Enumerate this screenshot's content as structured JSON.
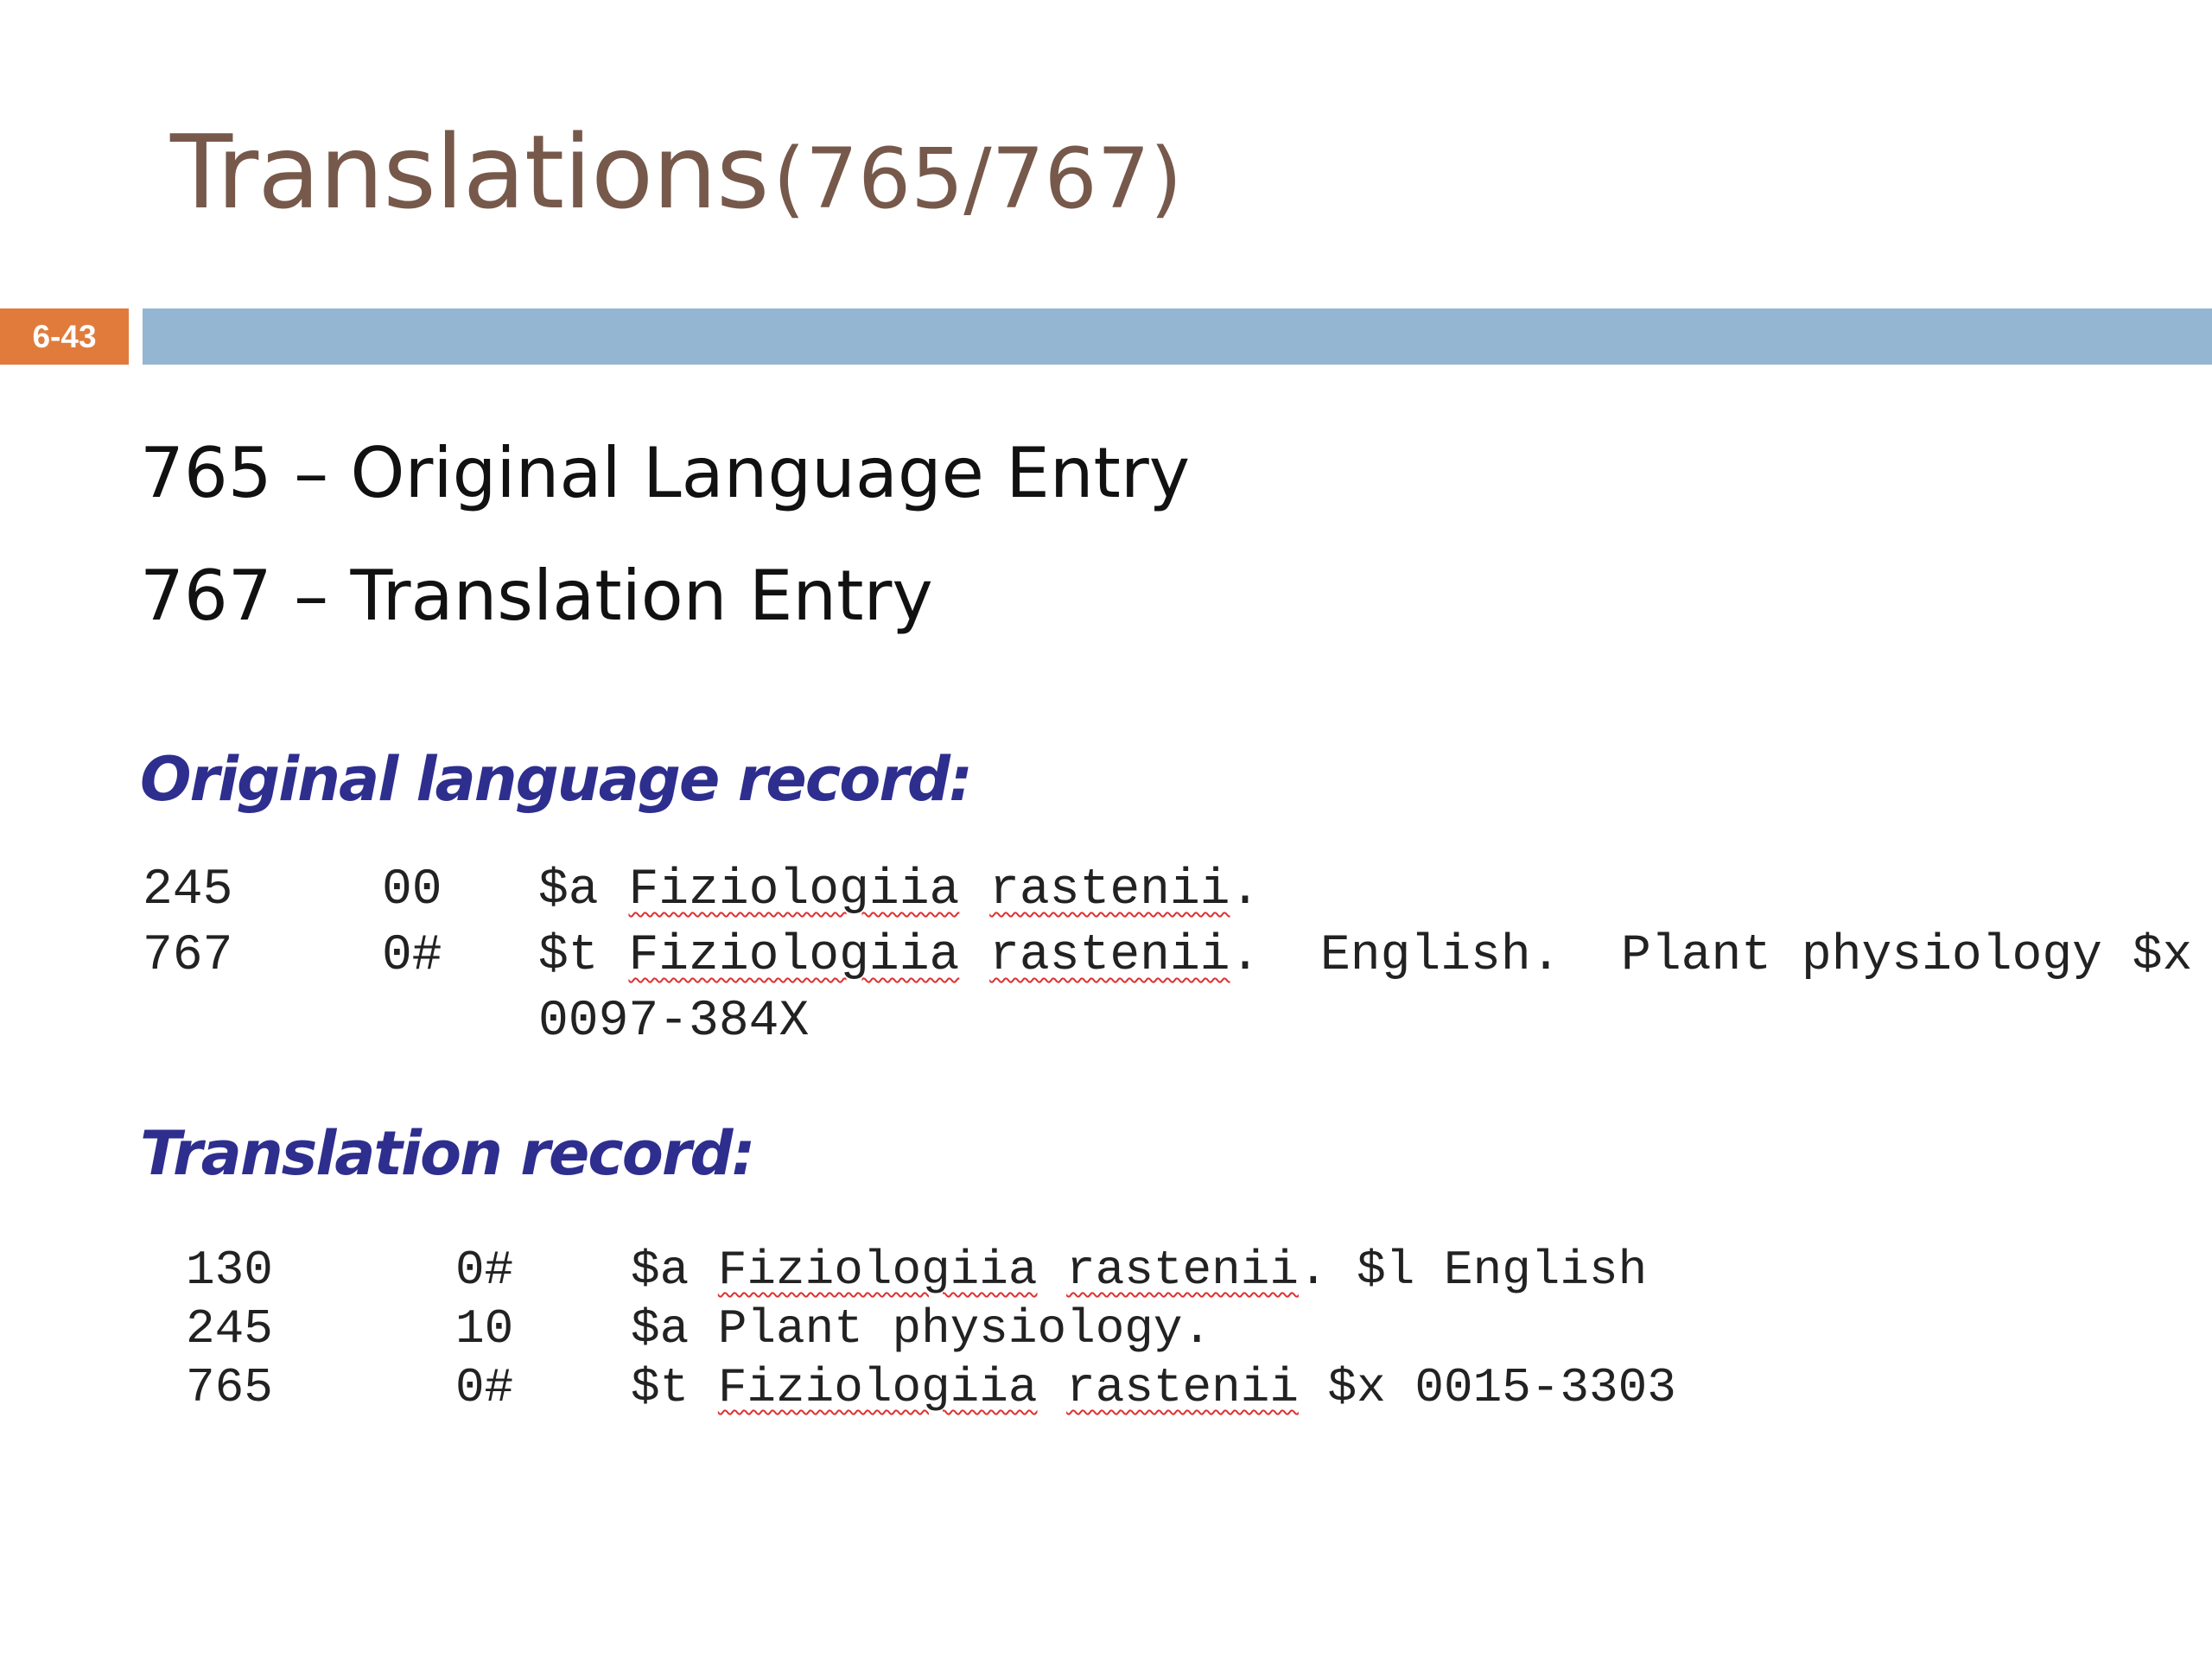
{
  "slide": {
    "title": "Translations",
    "title_paren": "(765/767)",
    "number": "6-43"
  },
  "entries": [
    "765 – Original Language Entry",
    "767 – Translation Entry"
  ],
  "original_record": {
    "heading": "Original language record:",
    "rows": [
      {
        "tag": "245",
        "ind": "00",
        "sub": "$a",
        "w1": "Fiziologiia",
        "w2": "rastenii",
        "rest": "."
      },
      {
        "tag": "767",
        "ind": "0#",
        "sub": "$t",
        "w1": "Fiziologiia",
        "w2": "rastenii",
        "rest": ".  English.  Plant physiology $x"
      },
      {
        "tag": "",
        "ind": "",
        "sub": "",
        "w1": "",
        "w2": "",
        "rest": "0097-384X"
      }
    ]
  },
  "translation_record": {
    "heading": "Translation record:",
    "rows": [
      {
        "tag": "130",
        "ind": "0#",
        "sub": "$a",
        "w1": "Fiziologiia",
        "w2": "rastenii",
        "rest": ". $l English"
      },
      {
        "tag": "245",
        "ind": "10",
        "sub": "$a",
        "w1": "",
        "w2": "",
        "rest": "Plant physiology."
      },
      {
        "tag": "765",
        "ind": "0#",
        "sub": "$t",
        "w1": "Fiziologiia",
        "w2": "rastenii",
        "rest": " $x 0015-3303"
      }
    ]
  },
  "colors": {
    "title": "#76594b",
    "slide_number_bg": "#e07b3c",
    "title_bar": "#94b6d3",
    "heading": "#2e2e8f",
    "spellcheck": "#e03030"
  }
}
